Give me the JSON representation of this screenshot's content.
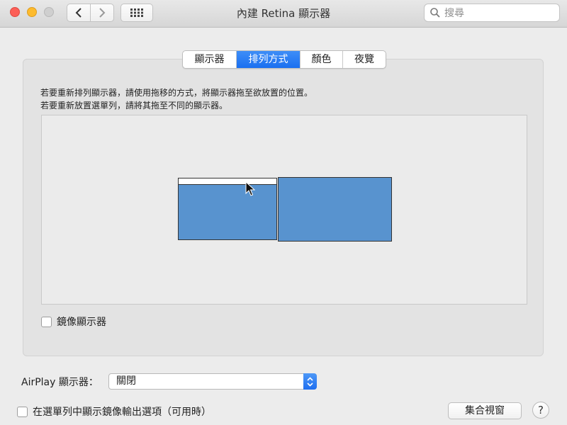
{
  "window": {
    "title": "內建 Retina 顯示器",
    "search_placeholder": "搜尋"
  },
  "tabs": [
    {
      "label": "顯示器",
      "active": false
    },
    {
      "label": "排列方式",
      "active": true
    },
    {
      "label": "顏色",
      "active": false
    },
    {
      "label": "夜覽",
      "active": false
    }
  ],
  "arrangement": {
    "instruction_line1": "若要重新排列顯示器，請使用拖移的方式，將顯示器拖至欲放置的位置。",
    "instruction_line2": "若要重新放置選單列，請將其拖至不同的顯示器。",
    "display_color": "#5893cf"
  },
  "mirror_displays": {
    "label": "鏡像顯示器",
    "checked": false
  },
  "airplay": {
    "label": "AirPlay 顯示器：",
    "selected": "關閉"
  },
  "menu_bar_option": {
    "label": "在選單列中顯示鏡像輸出選項（可用時）",
    "checked": false
  },
  "buttons": {
    "gather_windows": "集合視窗",
    "help": "?"
  },
  "colors": {
    "accent": "#1a6ff0",
    "close": "#fc5f57",
    "minimize": "#fdbb2e"
  }
}
